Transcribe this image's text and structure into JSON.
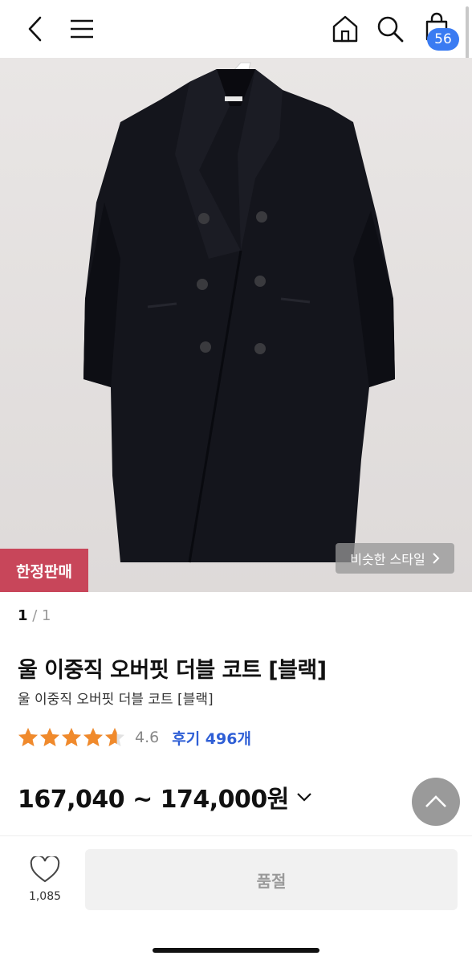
{
  "header": {
    "cart_count": "56",
    "icons": [
      "back-arrow-icon",
      "menu-icon",
      "home-icon",
      "search-icon",
      "shopping-bag-icon"
    ]
  },
  "image": {
    "limited_label": "한정판매",
    "similar_style_label": "비슷한 스타일",
    "pager_current": "1",
    "pager_rest": " / 1"
  },
  "product": {
    "title": "울 이중직 오버핏 더블 코트 [블랙]",
    "subtitle": "울 이중직 오버핏 더블 코트 [블랙]",
    "rating": "4.6",
    "rating_value": 4.6,
    "reviews": "후기 496개",
    "price": "167,040 ~ 174,000원"
  },
  "bottom_bar": {
    "like_count": "1,085",
    "soldout_label": "품절"
  },
  "colors": {
    "accent_blue": "#3a7bf2",
    "limited_red": "#c8465a",
    "star_orange": "#f08a2c",
    "review_blue": "#2f5fd6"
  }
}
